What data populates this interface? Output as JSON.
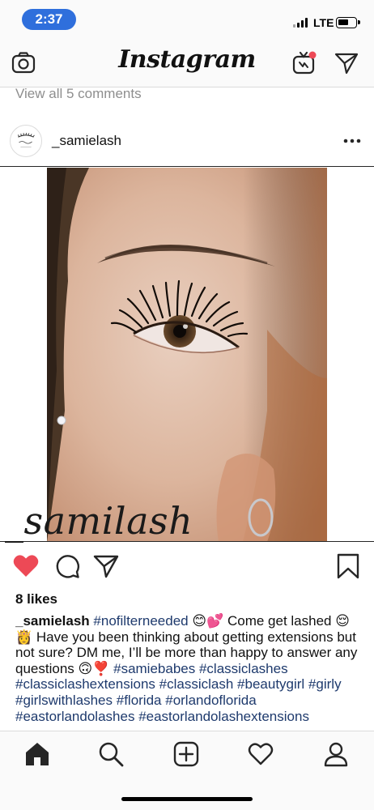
{
  "status_bar": {
    "time": "2:37",
    "network": "LTE",
    "time_pill_color": "#2f6fdc"
  },
  "header": {
    "title": "Instagram",
    "left_icon": "camera-icon",
    "right_icons": [
      "igtv-icon",
      "direct-message-icon"
    ],
    "notification_dot_color": "#ed4956"
  },
  "comments": {
    "view_all_label": "View all 5 comments"
  },
  "post": {
    "username": "_samielash",
    "avatar_icon": "lash-logo-avatar",
    "more_icon": "more-options-icon",
    "photo_watermark": "_samilash",
    "liked": true,
    "like_color": "#ed4956",
    "likes_text": "8 likes",
    "caption": {
      "user": "_samielash",
      "segments": [
        {
          "text": " ",
          "tag": false
        },
        {
          "text": "#nofilterneeded",
          "tag": true
        },
        {
          "text": " 😊💕 Come get lashed 😌👸 Have you been thinking about getting extensions but not sure? DM me, I’ll be more than happy to answer any questions 🙃❣️ ",
          "tag": false
        },
        {
          "text": "#samiebabes",
          "tag": true
        },
        {
          "text": " ",
          "tag": false
        },
        {
          "text": "#classiclashes",
          "tag": true
        },
        {
          "text": " ",
          "tag": false
        },
        {
          "text": "#classiclashextensions",
          "tag": true
        },
        {
          "text": " ",
          "tag": false
        },
        {
          "text": "#classiclash",
          "tag": true
        },
        {
          "text": " ",
          "tag": false
        },
        {
          "text": "#beautygirl",
          "tag": true
        },
        {
          "text": " ",
          "tag": false
        },
        {
          "text": "#girly",
          "tag": true
        },
        {
          "text": " ",
          "tag": false
        },
        {
          "text": "#girlswithlashes",
          "tag": true
        },
        {
          "text": " ",
          "tag": false
        },
        {
          "text": "#florida",
          "tag": true
        },
        {
          "text": " ",
          "tag": false
        },
        {
          "text": "#orlandoflorida",
          "tag": true
        },
        {
          "text": " ",
          "tag": false
        },
        {
          "text": "#eastorlandolashes",
          "tag": true
        },
        {
          "text": " ",
          "tag": false
        },
        {
          "text": "#eastorlandolashextensions",
          "tag": true
        }
      ]
    },
    "hashtag_color": "#1e3a6d"
  },
  "tab_bar": {
    "items": [
      "home-icon",
      "search-icon",
      "new-post-icon",
      "activity-heart-icon",
      "profile-icon"
    ],
    "active": "home-icon"
  }
}
